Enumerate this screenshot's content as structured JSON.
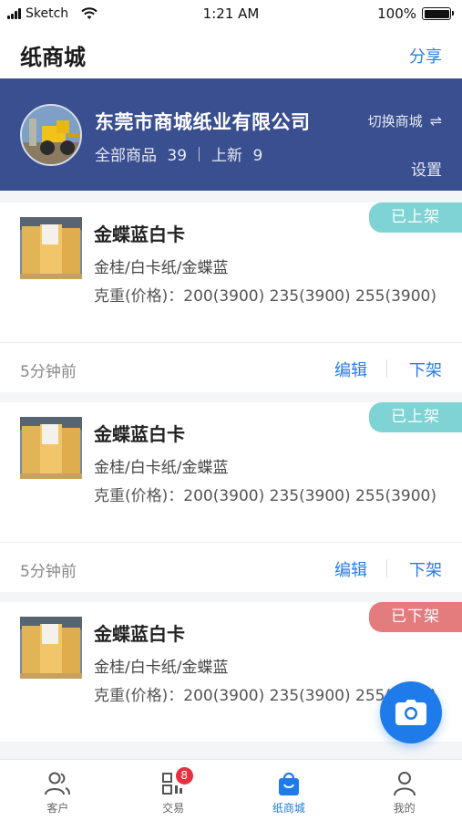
{
  "status_bar": {
    "carrier": "Sketch",
    "time": "1:21 AM",
    "battery": "100%"
  },
  "nav": {
    "title": "纸商城",
    "share_label": "分享"
  },
  "store": {
    "name": "东莞市商城纸业有限公司",
    "all_products_label": "全部商品",
    "all_products_count": "39",
    "new_label": "上新",
    "new_count": "9",
    "switch_label": "切换商城",
    "switch_icon": "⇌",
    "settings_label": "设置"
  },
  "products": [
    {
      "title": "金蝶蓝白卡",
      "category": "金桂/白卡纸/金蝶蓝",
      "spec": "克重(价格)：200(3900) 235(3900) 255(3900)",
      "status": "已上架",
      "time": "5分钟前",
      "edit_label": "编辑",
      "off_label": "下架"
    },
    {
      "title": "金蝶蓝白卡",
      "category": "金桂/白卡纸/金蝶蓝",
      "spec": "克重(价格)：200(3900) 235(3900) 255(3900)",
      "status": "已上架",
      "time": "5分钟前",
      "edit_label": "编辑",
      "off_label": "下架"
    },
    {
      "title": "金蝶蓝白卡",
      "category": "金桂/白卡纸/金蝶蓝",
      "spec": "克重(价格)：200(3900) 235(3900) 255(3900)",
      "status": "已下架",
      "time": "",
      "edit_label": "",
      "off_label": ""
    }
  ],
  "colors": {
    "listed": "#7fd3d4",
    "delisted": "#e47b7d",
    "accent": "#1f7bea",
    "header_bg": "#3a4f8f"
  },
  "tabs": [
    {
      "label": "客户",
      "icon": "user-group-icon"
    },
    {
      "label": "交易",
      "icon": "qr-code-icon",
      "badge": "8"
    },
    {
      "label": "纸商城",
      "icon": "shopping-bag-icon",
      "active": true
    },
    {
      "label": "我的",
      "icon": "person-icon"
    }
  ],
  "fab_icon": "camera-icon"
}
